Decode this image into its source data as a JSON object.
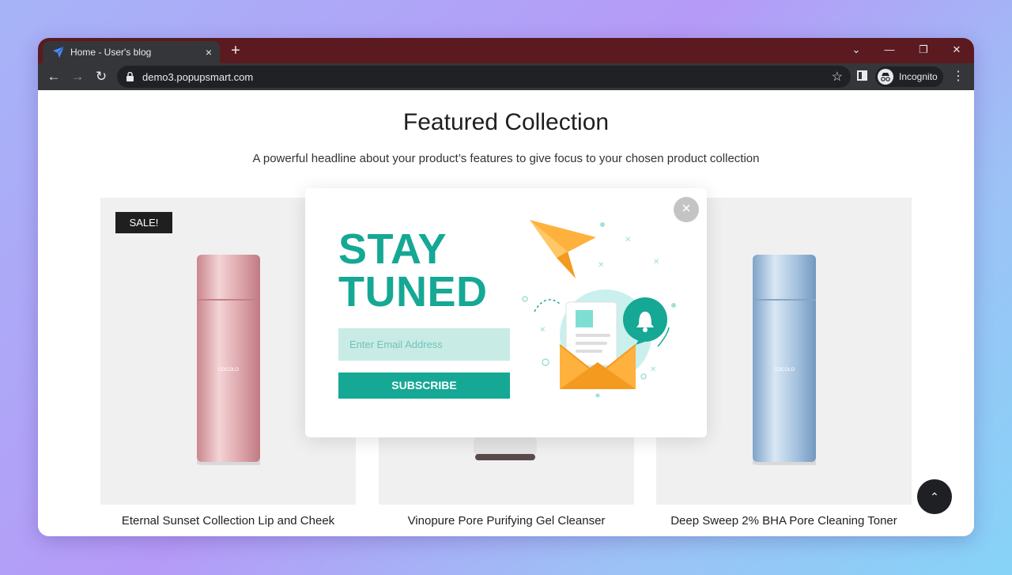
{
  "browser": {
    "tab_title": "Home - User's blog",
    "tab_close": "×",
    "new_tab": "+",
    "url": "demo3.popupsmart.com",
    "profile_label": "Incognito",
    "controls": {
      "tab_search": "⌄",
      "minimize": "—",
      "restore": "❐",
      "close": "✕"
    },
    "nav": {
      "back": "←",
      "forward": "→",
      "reload": "↻",
      "bookmark": "☆",
      "menu": "⋮"
    }
  },
  "page": {
    "heading": "Featured Collection",
    "subheading": "A powerful headline about your product’s features to give focus to your chosen product collection",
    "products": [
      {
        "name": "Eternal Sunset Collection Lip and Cheek",
        "badge": "SALE!",
        "bottle_brand": "COCOLO",
        "bottle_color": "#d99aa0"
      },
      {
        "name": "Vinopure Pore Purifying Gel Cleanser",
        "bottle_color": "#e8e8e8"
      },
      {
        "name": "Deep Sweep 2% BHA Pore Cleaning Toner",
        "bottle_brand": "COCOLO",
        "bottle_color": "#a9c6e2"
      }
    ],
    "scroll_top": "⌃"
  },
  "popup": {
    "headline_line1": "STAY",
    "headline_line2": "TUNED",
    "email_placeholder": "Enter Email Address",
    "subscribe_label": "SUBSCRIBE",
    "close": "×",
    "accent_color": "#15a895"
  }
}
